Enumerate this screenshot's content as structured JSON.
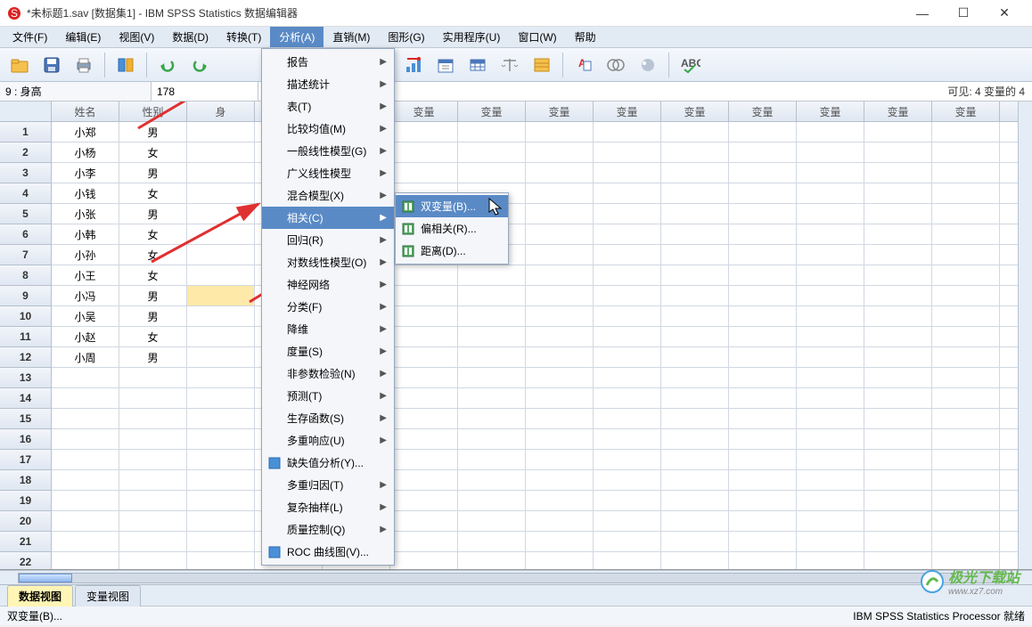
{
  "window": {
    "title": "*未标题1.sav [数据集1] - IBM SPSS Statistics 数据编辑器",
    "min": "—",
    "max": "☐",
    "close": "✕"
  },
  "menu": {
    "items": [
      "文件(F)",
      "编辑(E)",
      "视图(V)",
      "数据(D)",
      "转换(T)",
      "分析(A)",
      "直销(M)",
      "图形(G)",
      "实用程序(U)",
      "窗口(W)",
      "帮助"
    ],
    "hot_index": 5
  },
  "cellbar": {
    "addr": "9 : 身高",
    "value": "178",
    "right": "可见: 4 变量的 4"
  },
  "headers": [
    "姓名",
    "性别",
    "身",
    "变量",
    "变量",
    "变量",
    "变量",
    "变量",
    "变量",
    "变量",
    "变量",
    "变量",
    "变量",
    "变量",
    "变量"
  ],
  "rows": [
    {
      "n": "1",
      "name": "小郑",
      "sex": "男"
    },
    {
      "n": "2",
      "name": "小杨",
      "sex": "女"
    },
    {
      "n": "3",
      "name": "小李",
      "sex": "男"
    },
    {
      "n": "4",
      "name": "小钱",
      "sex": "女"
    },
    {
      "n": "5",
      "name": "小张",
      "sex": "男"
    },
    {
      "n": "6",
      "name": "小韩",
      "sex": "女"
    },
    {
      "n": "7",
      "name": "小孙",
      "sex": "女"
    },
    {
      "n": "8",
      "name": "小王",
      "sex": "女"
    },
    {
      "n": "9",
      "name": "小冯",
      "sex": "男"
    },
    {
      "n": "10",
      "name": "小吴",
      "sex": "男"
    },
    {
      "n": "11",
      "name": "小赵",
      "sex": "女"
    },
    {
      "n": "12",
      "name": "小周",
      "sex": "男"
    },
    {
      "n": "13",
      "name": "",
      "sex": ""
    },
    {
      "n": "14",
      "name": "",
      "sex": ""
    },
    {
      "n": "15",
      "name": "",
      "sex": ""
    },
    {
      "n": "16",
      "name": "",
      "sex": ""
    },
    {
      "n": "17",
      "name": "",
      "sex": ""
    },
    {
      "n": "18",
      "name": "",
      "sex": ""
    },
    {
      "n": "19",
      "name": "",
      "sex": ""
    },
    {
      "n": "20",
      "name": "",
      "sex": ""
    },
    {
      "n": "21",
      "name": "",
      "sex": ""
    },
    {
      "n": "22",
      "name": "",
      "sex": ""
    }
  ],
  "analyze_menu": [
    {
      "label": "报告",
      "sub": true
    },
    {
      "label": "描述统计",
      "sub": true
    },
    {
      "label": "表(T)",
      "sub": true
    },
    {
      "label": "比较均值(M)",
      "sub": true
    },
    {
      "label": "一般线性模型(G)",
      "sub": true
    },
    {
      "label": "广义线性模型",
      "sub": true
    },
    {
      "label": "混合模型(X)",
      "sub": true
    },
    {
      "label": "相关(C)",
      "sub": true,
      "hot": true
    },
    {
      "label": "回归(R)",
      "sub": true
    },
    {
      "label": "对数线性模型(O)",
      "sub": true
    },
    {
      "label": "神经网络",
      "sub": true
    },
    {
      "label": "分类(F)",
      "sub": true
    },
    {
      "label": "降维",
      "sub": true
    },
    {
      "label": "度量(S)",
      "sub": true
    },
    {
      "label": "非参数检验(N)",
      "sub": true
    },
    {
      "label": "预测(T)",
      "sub": true
    },
    {
      "label": "生存函数(S)",
      "sub": true
    },
    {
      "label": "多重响应(U)",
      "sub": true
    },
    {
      "label": "缺失值分析(Y)...",
      "sub": false,
      "icon": "mv"
    },
    {
      "label": "多重归因(T)",
      "sub": true
    },
    {
      "label": "复杂抽样(L)",
      "sub": true
    },
    {
      "label": "质量控制(Q)",
      "sub": true
    },
    {
      "label": "ROC 曲线图(V)...",
      "sub": false,
      "icon": "roc"
    }
  ],
  "corr_submenu": [
    {
      "label": "双变量(B)...",
      "icon": "biv",
      "hot": true
    },
    {
      "label": "偏相关(R)...",
      "icon": "part"
    },
    {
      "label": "距离(D)...",
      "icon": "dist"
    }
  ],
  "tabs": {
    "active": "数据视图",
    "other": "变量视图"
  },
  "status": {
    "left": "双变量(B)...",
    "right": "IBM SPSS Statistics Processor 就绪"
  },
  "watermark": "极光下载站",
  "watermark_url": "www.xz7.com"
}
